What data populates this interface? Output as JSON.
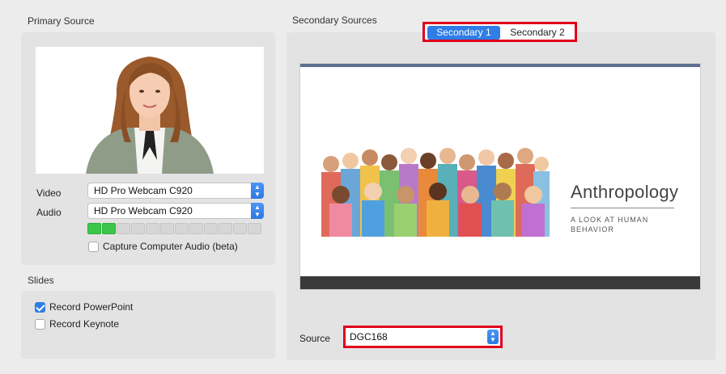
{
  "primary": {
    "title": "Primary Source",
    "video_label": "Video",
    "video_value": "HD Pro Webcam C920",
    "audio_label": "Audio",
    "audio_value": "HD Pro Webcam C920",
    "audio_meter": {
      "segments": 12,
      "active": 2
    },
    "capture_audio_label": "Capture Computer Audio (beta)",
    "capture_audio_checked": false
  },
  "slides": {
    "title": "Slides",
    "record_powerpoint_label": "Record PowerPoint",
    "record_powerpoint_checked": true,
    "record_keynote_label": "Record Keynote",
    "record_keynote_checked": false
  },
  "secondary": {
    "title": "Secondary Sources",
    "tabs": [
      {
        "label": "Secondary 1",
        "active": true
      },
      {
        "label": "Secondary 2",
        "active": false
      }
    ],
    "preview": {
      "slide_title": "Anthropology",
      "slide_subtitle": "A LOOK AT HUMAN BEHAVIOR"
    },
    "source_label": "Source",
    "source_value": "DGC168"
  },
  "colors": {
    "accent": "#2f7de6",
    "highlight": "#e0001b",
    "meter_on": "#3bc64a"
  }
}
